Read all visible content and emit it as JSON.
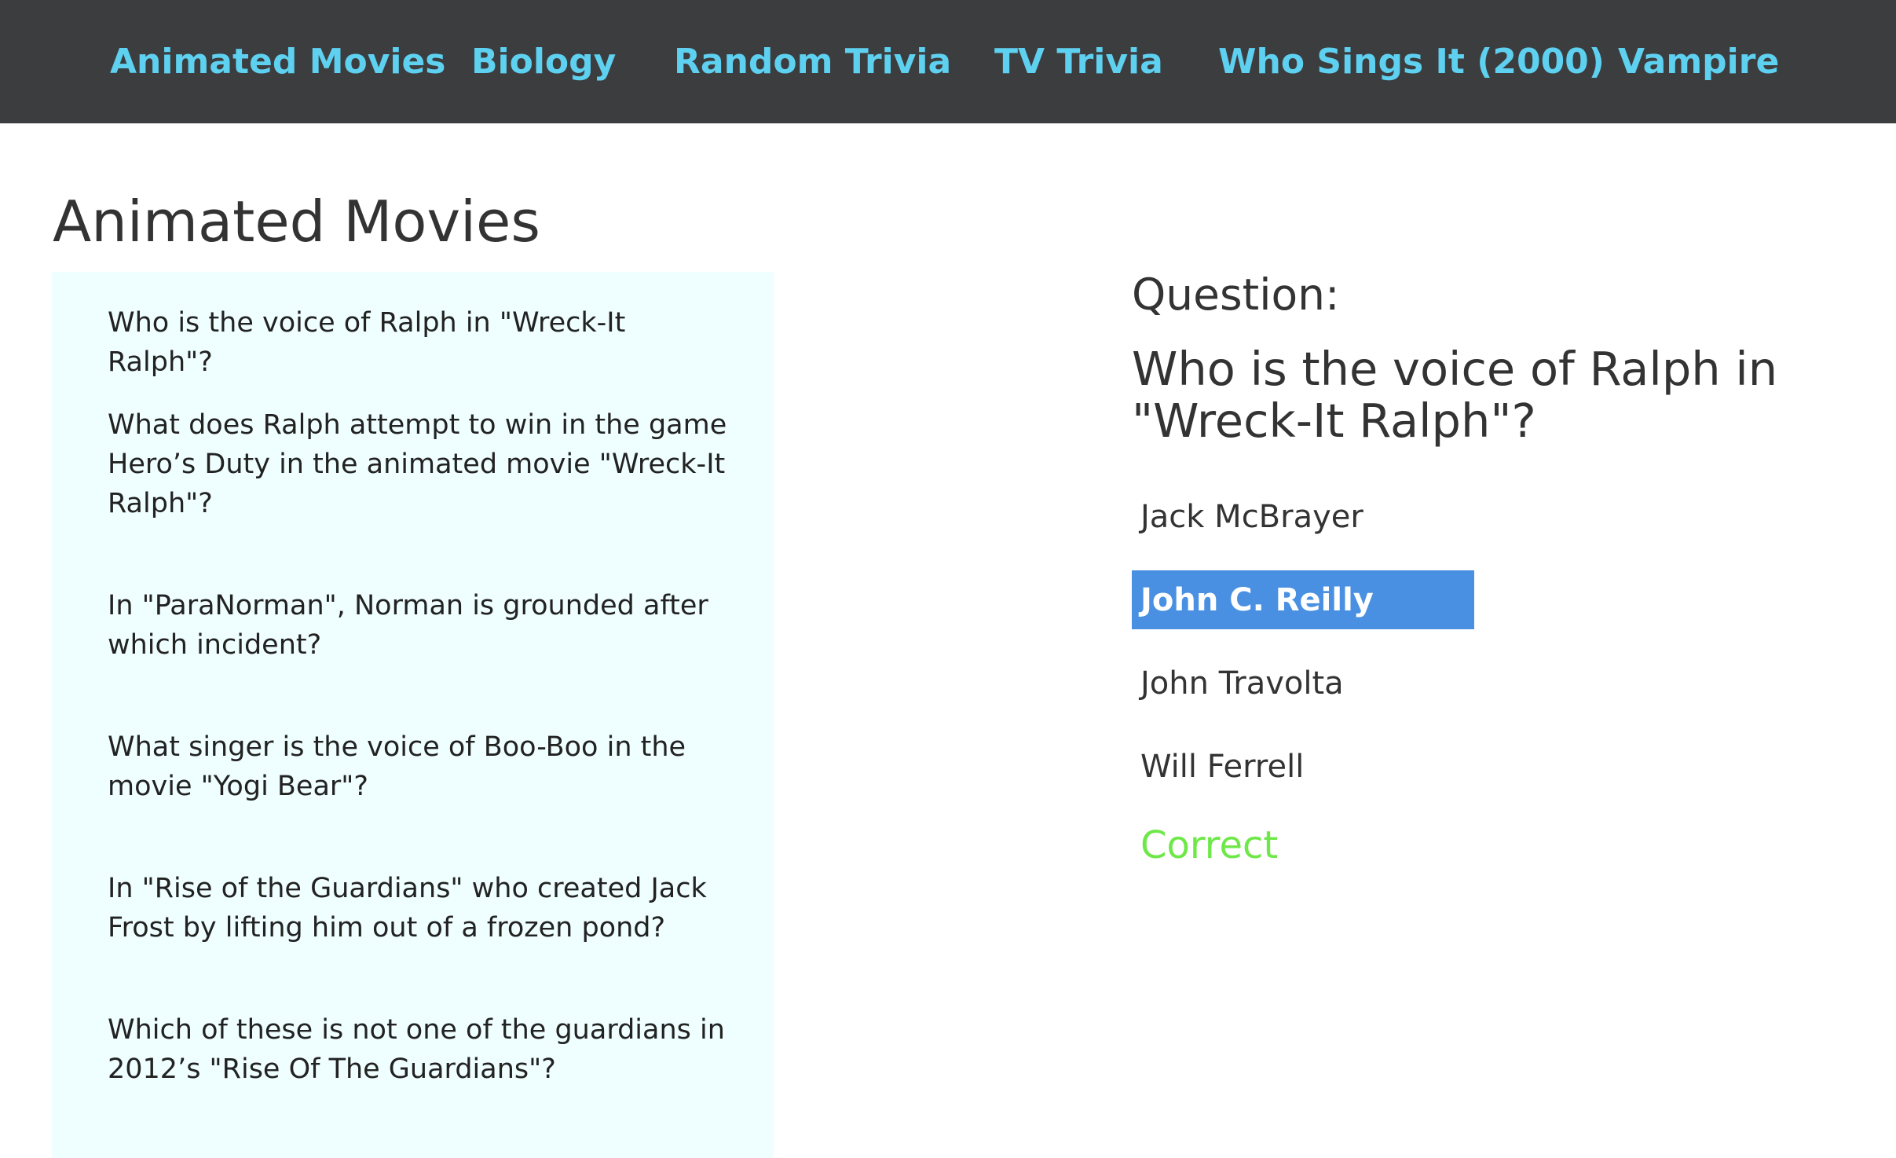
{
  "nav": {
    "items": [
      {
        "label": "Animated Movies"
      },
      {
        "label": "Biology"
      },
      {
        "label": "Random Trivia"
      },
      {
        "label": "TV Trivia"
      },
      {
        "label": "Who Sings It (2000)"
      },
      {
        "label": "Vampire"
      }
    ]
  },
  "section": {
    "title": "Animated Movies"
  },
  "questions": [
    {
      "text": "Who is the voice of Ralph in \"Wreck-It Ralph\"?"
    },
    {
      "text": "What does Ralph attempt to win in the game Hero’s Duty in the animated movie \"Wreck-It Ralph\"?"
    },
    {
      "text": "In \"ParaNorman\", Norman is grounded after which incident?"
    },
    {
      "text": "What singer is the voice of Boo-Boo in the movie \"Yogi Bear\"?"
    },
    {
      "text": "In \"Rise of the Guardians\" who created Jack Frost by lifting him out of a frozen pond?"
    },
    {
      "text": "Which of these is not one of the guardians in 2012’s \"Rise Of The Guardians\"?"
    }
  ],
  "current": {
    "label": "Question:",
    "text": "Who is the voice of Ralph in \"Wreck-It Ralph\"?",
    "answers": [
      {
        "label": "Jack McBrayer"
      },
      {
        "label": "John C. Reilly"
      },
      {
        "label": "John Travolta"
      },
      {
        "label": "Will Ferrell"
      }
    ],
    "selected_answer": "John C. Reilly",
    "result": "Correct"
  },
  "colors": {
    "nav_background": "#3c3d3f",
    "nav_link": "#5ed0f0",
    "list_background": "#effefe",
    "selected_background": "#4a90e2",
    "correct": "#6ee848"
  }
}
